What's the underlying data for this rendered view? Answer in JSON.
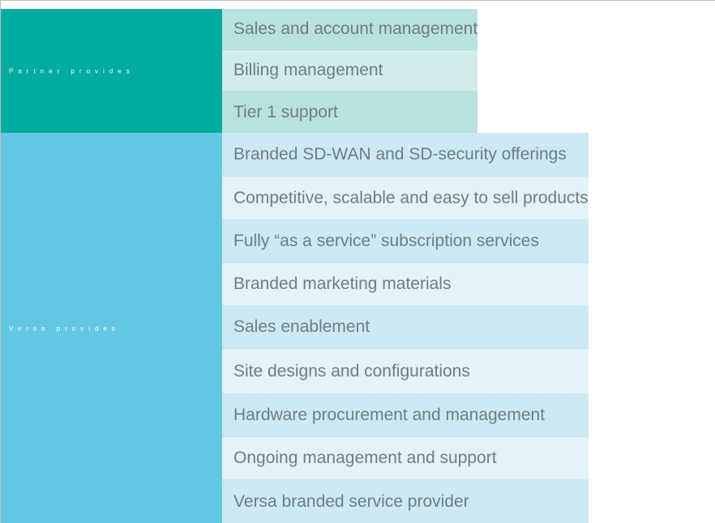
{
  "groups": [
    {
      "label": "Partner provides",
      "colors": {
        "label_bg": "#00aba0",
        "row_a": "#b8e2df",
        "row_b": "#d1ecea"
      },
      "items": [
        "Sales and account management",
        "Billing management",
        "Tier 1 support"
      ]
    },
    {
      "label": "Versa provides",
      "colors": {
        "label_bg": "#63c8e4",
        "row_a": "#cde9f3",
        "row_b": "#e2f3f9"
      },
      "items": [
        "Branded SD-WAN and SD-security offerings",
        "Competitive, scalable and easy to sell products",
        "Fully “as a service” subscription services",
        "Branded marketing materials",
        "Sales enablement",
        "Site designs and configurations",
        "Hardware procurement and management",
        "Ongoing management and support",
        "Versa branded service provider"
      ]
    }
  ]
}
